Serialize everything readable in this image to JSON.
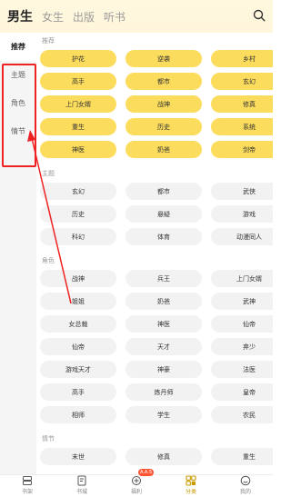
{
  "header": {
    "tabs": [
      {
        "label": "男生",
        "active": true
      },
      {
        "label": "女生",
        "active": false
      },
      {
        "label": "出版",
        "active": false
      },
      {
        "label": "听书",
        "active": false
      }
    ],
    "search_icon": "search-icon"
  },
  "sidebar": {
    "items": [
      {
        "label": "推荐",
        "active": true
      },
      {
        "label": "主题",
        "active": false
      },
      {
        "label": "角色",
        "active": false
      },
      {
        "label": "情节",
        "active": false
      }
    ],
    "highlight_color": "#ee2222"
  },
  "sections": {
    "recommend": {
      "title": "推荐",
      "tags": [
        "护花",
        "逆袭",
        "乡村",
        "高手",
        "都市",
        "玄幻",
        "上门女婿",
        "战神",
        "修真",
        "重生",
        "历史",
        "系统",
        "神医",
        "奶爸",
        "剑帝"
      ]
    },
    "theme": {
      "title": "主题",
      "tags": [
        "玄幻",
        "都市",
        "武侠",
        "历史",
        "悬疑",
        "游戏",
        "科幻",
        "体育",
        "动漫同人"
      ]
    },
    "role": {
      "title": "角色",
      "tags": [
        "战神",
        "兵王",
        "上门女婿",
        "姐姐",
        "奶爸",
        "武神",
        "女总裁",
        "神医",
        "仙帝",
        "仙帝",
        "天才",
        "弃少",
        "游戏天才",
        "神豪",
        "法医",
        "高手",
        "炼丹师",
        "皇帝",
        "相师",
        "学生",
        "农民"
      ]
    },
    "plot": {
      "title": "情节",
      "tags": [
        "末世",
        "修真",
        "重生"
      ]
    }
  },
  "bottom_nav": {
    "items": [
      {
        "label": "书架",
        "icon": "bookshelf-icon",
        "active": false
      },
      {
        "label": "书城",
        "icon": "bookstore-icon",
        "active": false
      },
      {
        "label": "福利",
        "icon": "gift-icon",
        "active": false,
        "badge": "A.A.S"
      },
      {
        "label": "分类",
        "icon": "category-icon",
        "active": true
      },
      {
        "label": "我的",
        "icon": "profile-icon",
        "active": false
      }
    ]
  },
  "colors": {
    "accent": "#fcdc5c",
    "chip_gray": "#f2f2f2",
    "annotation": "#ee2222"
  }
}
